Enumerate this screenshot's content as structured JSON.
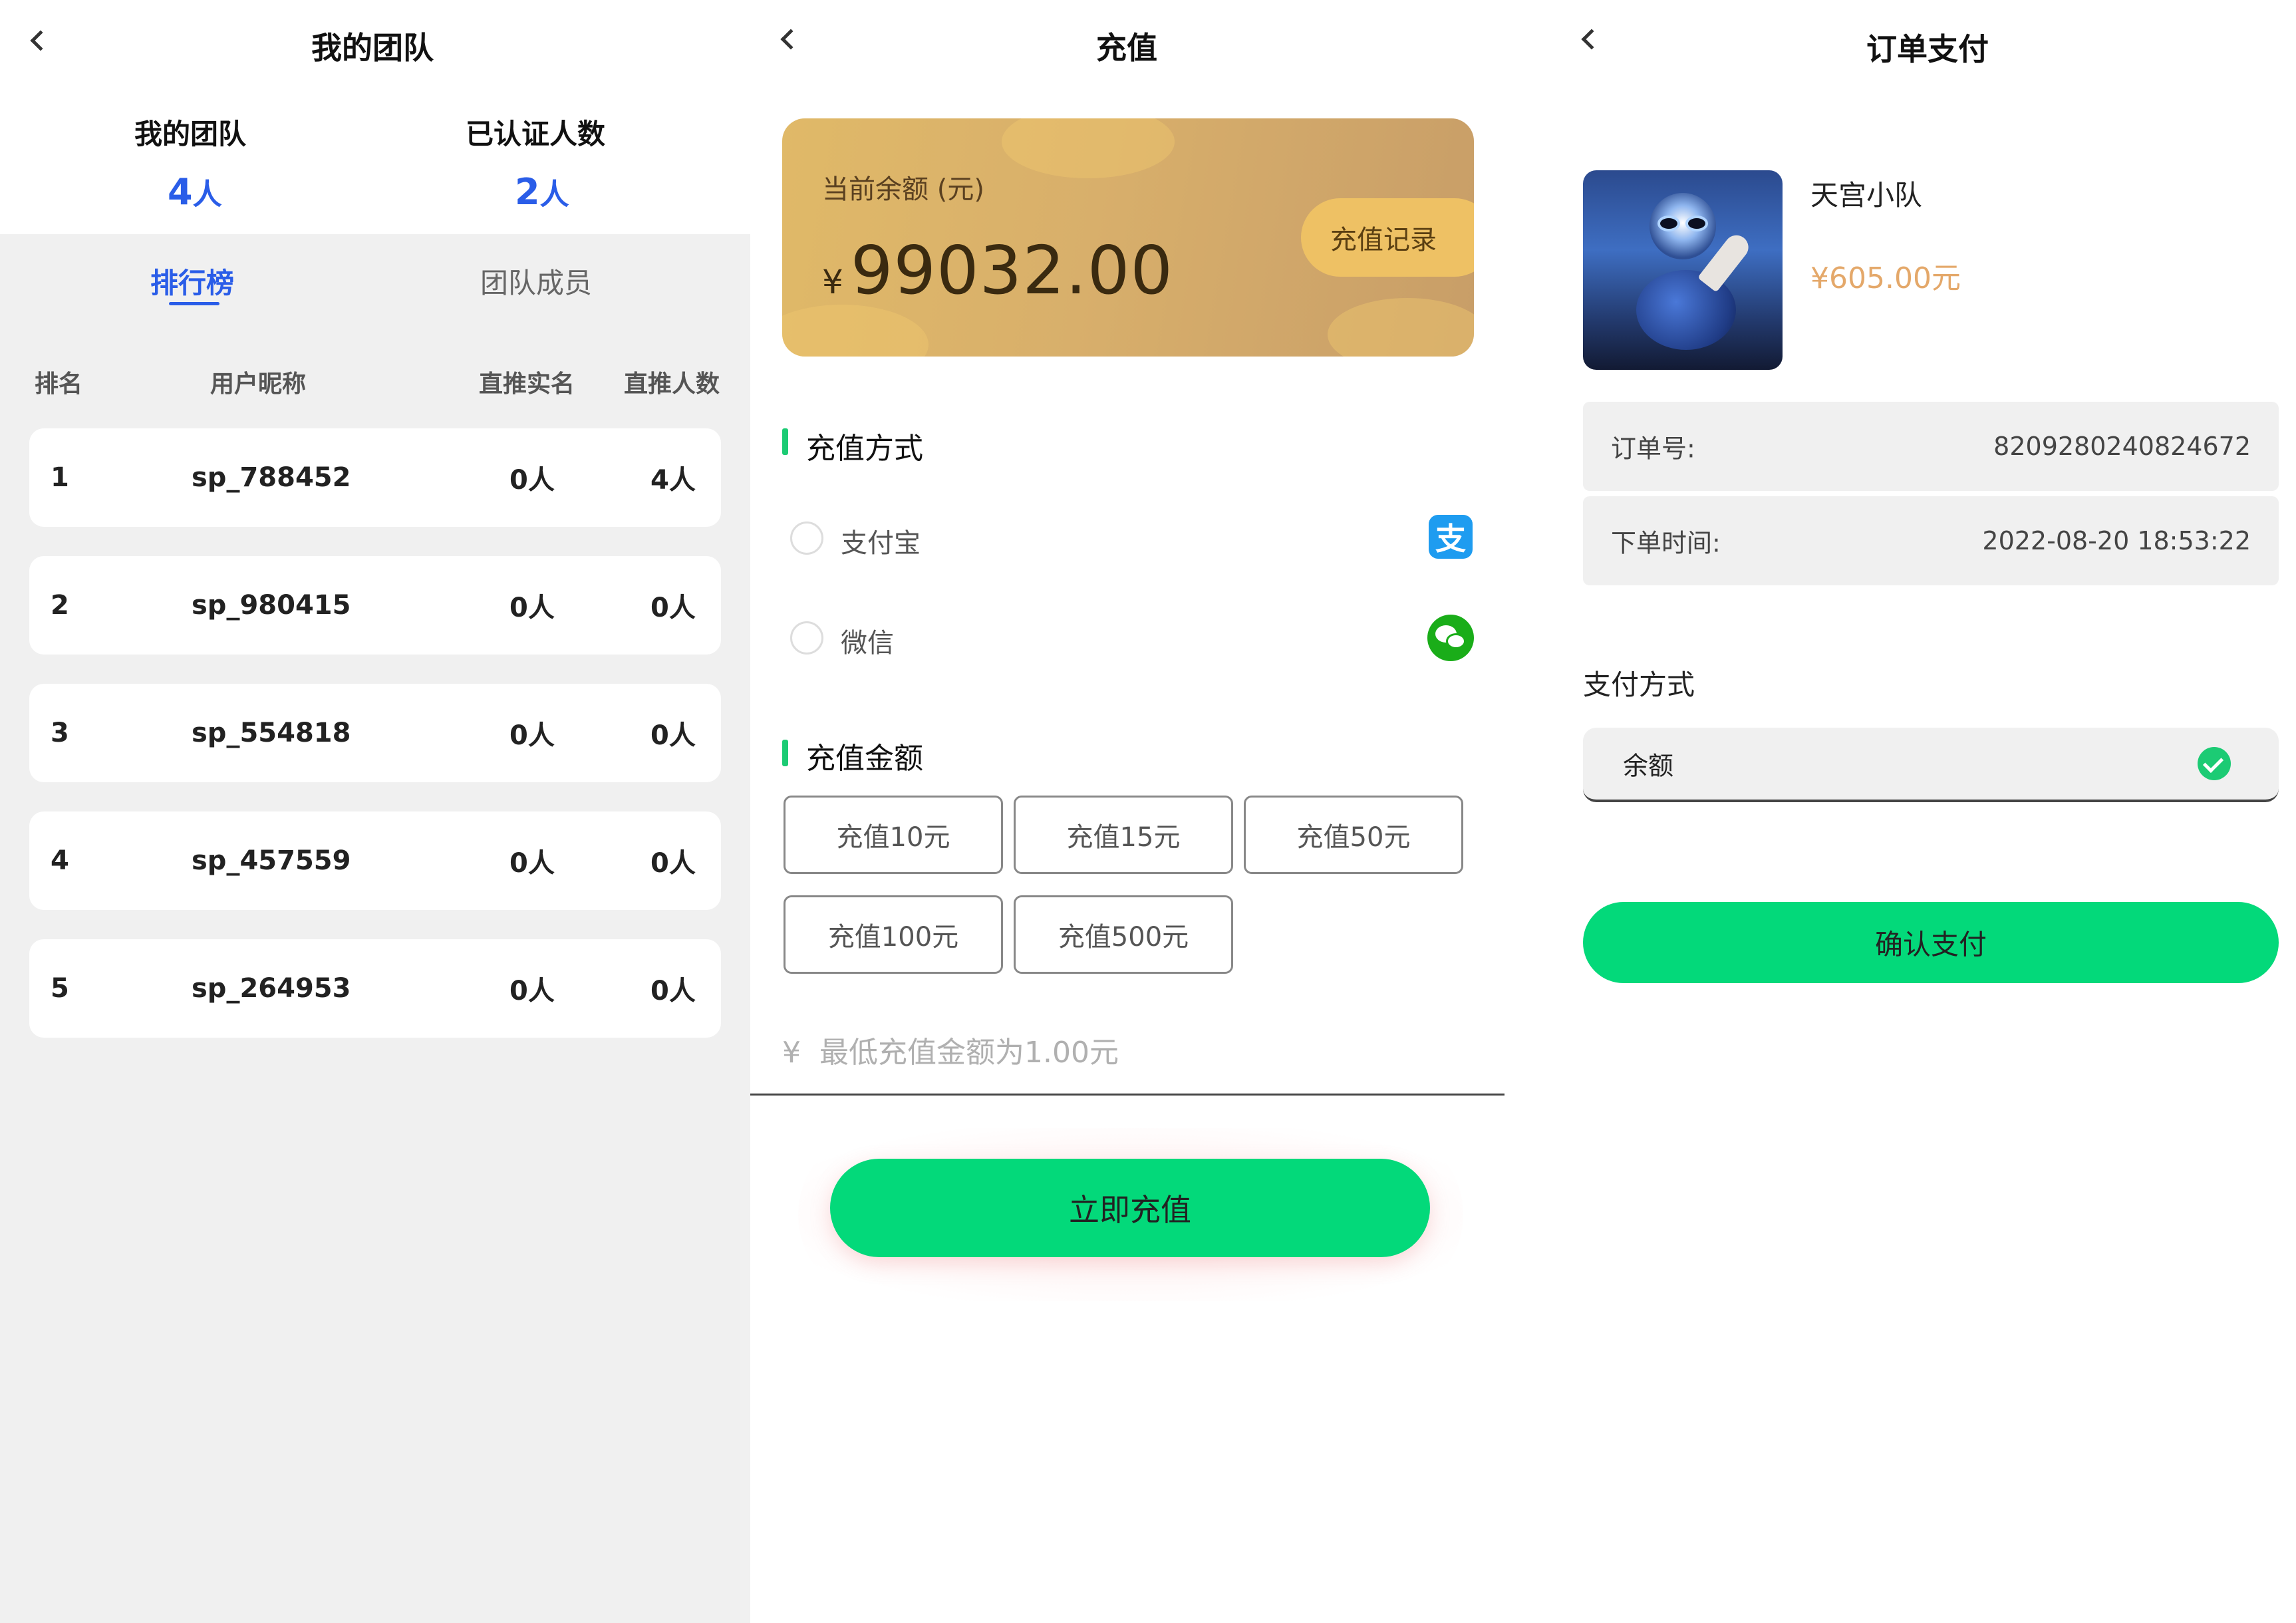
{
  "team": {
    "title": "我的团队",
    "stats": [
      {
        "label": "我的团队",
        "value": "4",
        "unit": "人"
      },
      {
        "label": "已认证人数",
        "value": "2",
        "unit": "人"
      }
    ],
    "tabs": [
      {
        "label": "排行榜",
        "active": true
      },
      {
        "label": "团队成员",
        "active": false
      }
    ],
    "columns": [
      "排名",
      "用户昵称",
      "直推实名",
      "直推人数"
    ],
    "rows": [
      {
        "rank": "1",
        "nickname": "sp_788452",
        "real_name": "0人",
        "direct": "4人"
      },
      {
        "rank": "2",
        "nickname": "sp_980415",
        "real_name": "0人",
        "direct": "0人"
      },
      {
        "rank": "3",
        "nickname": "sp_554818",
        "real_name": "0人",
        "direct": "0人"
      },
      {
        "rank": "4",
        "nickname": "sp_457559",
        "real_name": "0人",
        "direct": "0人"
      },
      {
        "rank": "5",
        "nickname": "sp_264953",
        "real_name": "0人",
        "direct": "0人"
      }
    ]
  },
  "recharge": {
    "title": "充值",
    "balance_label": "当前余额 (元)",
    "currency": "¥",
    "balance": "99032.00",
    "record_button": "充值记录",
    "method_title": "充值方式",
    "methods": [
      {
        "label": "支付宝",
        "icon": "alipay-icon"
      },
      {
        "label": "微信",
        "icon": "wechat-icon"
      }
    ],
    "amount_title": "充值金额",
    "amounts": [
      "充值10元",
      "充值15元",
      "充值50元",
      "充值100元",
      "充值500元"
    ],
    "amount_placeholder": "最低充值金额为1.00元",
    "amount_prefix": "¥",
    "submit": "立即充值"
  },
  "order": {
    "title": "订单支付",
    "product_name": "天宫小队",
    "price": "¥605.00元",
    "order_no_label": "订单号:",
    "order_no": "8209280240824672",
    "time_label": "下单时间:",
    "time": "2022-08-20 18:53:22",
    "pay_method_title": "支付方式",
    "pay_option": "余额",
    "confirm": "确认支付"
  },
  "colors": {
    "accent_blue": "#2a5de8",
    "green": "#03d97a",
    "gold": "#d8af6b",
    "price": "#e4a86a"
  }
}
